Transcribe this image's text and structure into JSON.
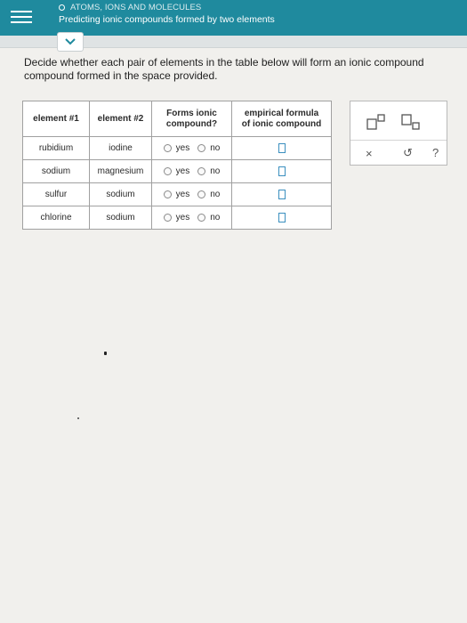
{
  "header": {
    "topic": "ATOMS, IONS AND MOLECULES",
    "title": "Predicting ionic compounds formed by two elements"
  },
  "question": {
    "line1": "Decide whether each pair of elements in the table below will form an ionic compound",
    "line2": "compound formed in the space provided."
  },
  "table": {
    "headers": {
      "element1": "element #1",
      "element2": "element #2",
      "forms_ionic_line1": "Forms ionic",
      "forms_ionic_line2": "compound?",
      "formula_line1": "empirical formula",
      "formula_line2": "of ionic compound"
    },
    "yes_label": "yes",
    "no_label": "no",
    "rows": [
      {
        "element1": "rubidium",
        "element2": "iodine"
      },
      {
        "element1": "sodium",
        "element2": "magnesium"
      },
      {
        "element1": "sulfur",
        "element2": "sodium"
      },
      {
        "element1": "chlorine",
        "element2": "sodium"
      }
    ]
  },
  "tools": {
    "clear": "×",
    "undo": "↺",
    "help": "?"
  },
  "colors": {
    "header": "#1f8a9e",
    "formula_box": "#3b8fbf"
  }
}
